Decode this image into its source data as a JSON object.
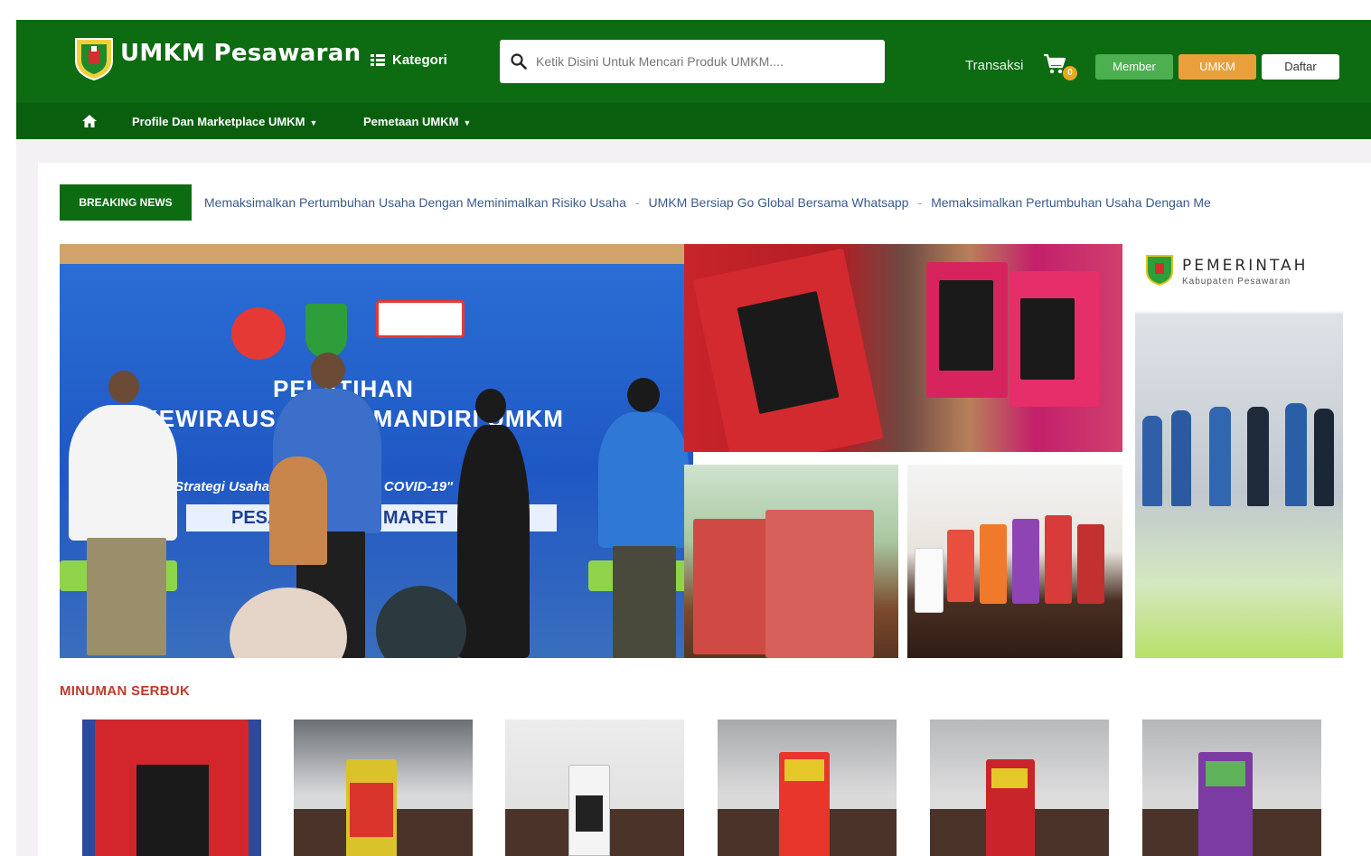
{
  "header": {
    "brand": "UMKM Pesawaran",
    "kategori_label": "Kategori",
    "search_placeholder": "Ketik Disini Untuk Mencari Produk UMKM....",
    "transaksi_label": "Transaksi",
    "cart_count": "0",
    "buttons": {
      "member": "Member",
      "umkm": "UMKM",
      "daftar": "Daftar"
    }
  },
  "nav": {
    "items": [
      {
        "label": "Profile Dan Marketplace UMKM"
      },
      {
        "label": "Pemetaan UMKM"
      }
    ]
  },
  "breaking_news": {
    "label": "BREAKING NEWS",
    "items": [
      "Memaksimalkan Pertumbuhan Usaha Dengan Meminimalkan Risiko Usaha",
      "UMKM Bersiap Go Global Bersama Whatsapp",
      "Memaksimalkan Pertumbuhan Usaha Dengan Me"
    ],
    "separator": "-"
  },
  "hero": {
    "title_line1": "PELATIHAN",
    "title_line2": "KEWIRAUSAHAAN MANDIRI UMKM",
    "slogan": "\"Strategi Usaha dimasa Pandemi COVID-19\"",
    "ribbon": "PESAWARAN, 17 MARET"
  },
  "side_banner": {
    "title": "PEMERINTAH",
    "subtitle": "Kabupaten Pesawaran"
  },
  "section": {
    "title": "MINUMAN SERBUK"
  },
  "colors": {
    "brand_green": "#0d6b12",
    "nav_green": "#0a5f0f",
    "accent_orange": "#e9a03c",
    "member_green": "#4caf50",
    "section_red": "#c0392b"
  },
  "icons": [
    "logo-shield-icon",
    "list-icon",
    "search-icon",
    "cart-icon",
    "home-icon",
    "caret-down-icon"
  ]
}
